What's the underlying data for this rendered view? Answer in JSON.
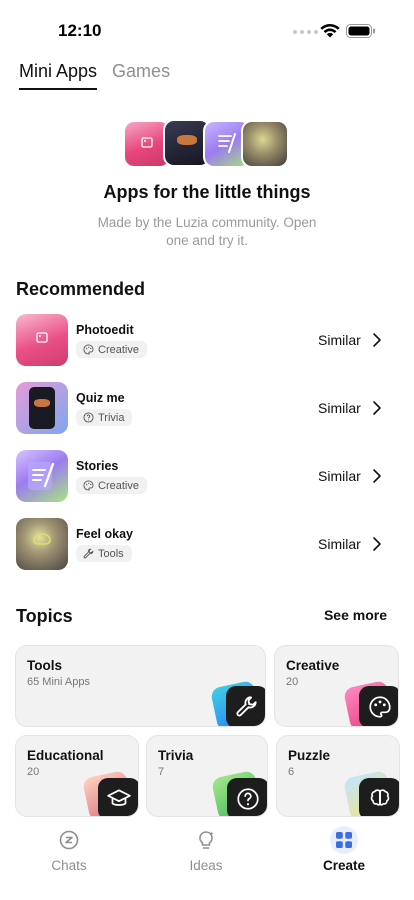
{
  "status_bar": {
    "time": "12:10"
  },
  "tabs": [
    {
      "label": "Mini Apps",
      "active": true
    },
    {
      "label": "Games",
      "active": false
    }
  ],
  "hero": {
    "title": "Apps for the little things",
    "subtitle": "Made by the Luzia community. Open one and try it."
  },
  "recommended": {
    "title": "Recommended",
    "items": [
      {
        "name": "Photoedit",
        "tag": "Creative",
        "tag_icon": "palette-icon",
        "action": "Similar"
      },
      {
        "name": "Quiz me",
        "tag": "Trivia",
        "tag_icon": "question-circle-icon",
        "action": "Similar"
      },
      {
        "name": "Stories",
        "tag": "Creative",
        "tag_icon": "palette-icon",
        "action": "Similar"
      },
      {
        "name": "Feel okay",
        "tag": "Tools",
        "tag_icon": "wrench-icon",
        "action": "Similar"
      }
    ]
  },
  "topics": {
    "title": "Topics",
    "see_more": "See more",
    "cards": [
      {
        "name": "Tools",
        "count": "65 Mini Apps",
        "icon": "wrench-icon"
      },
      {
        "name": "Creative",
        "count": "20",
        "icon": "palette-icon"
      },
      {
        "name": "Educational",
        "count": "20",
        "icon": "graduation-cap-icon"
      },
      {
        "name": "Trivia",
        "count": "7",
        "icon": "question-circle-icon"
      },
      {
        "name": "Puzzle",
        "count": "6",
        "icon": "brain-icon"
      }
    ]
  },
  "bottom_nav": [
    {
      "label": "Chats",
      "icon": "chat-icon",
      "active": false
    },
    {
      "label": "Ideas",
      "icon": "lightbulb-icon",
      "active": false
    },
    {
      "label": "Create",
      "icon": "grid-icon",
      "active": true
    }
  ],
  "colors": {
    "accent_blue": "#3b6fe0",
    "card_bg": "#f2f2f2",
    "muted_text": "#9a9a9a"
  }
}
